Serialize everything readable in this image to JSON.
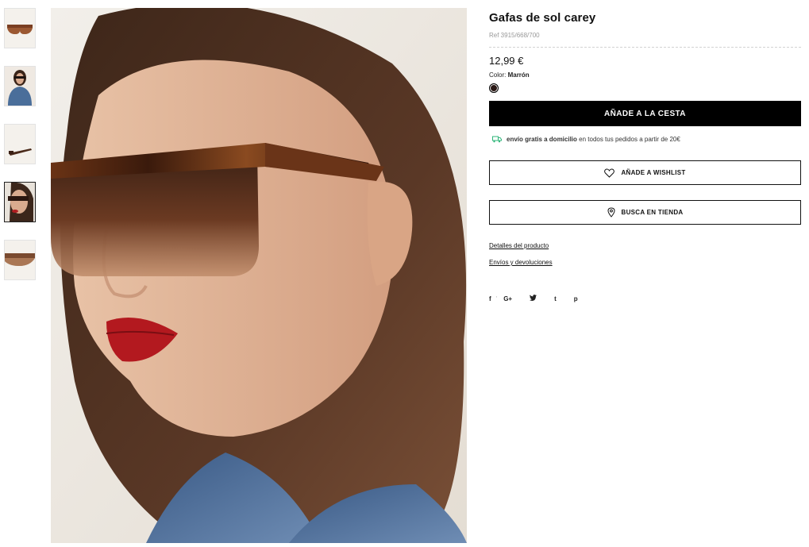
{
  "product": {
    "title": "Gafas de sol carey",
    "ref": "Ref 3915/668/700",
    "price": "12,99 €",
    "color_label": "Color:",
    "color_value": "Marrón",
    "swatch_color": "#2a1815"
  },
  "actions": {
    "add_to_cart": "AÑADE A LA CESTA",
    "wishlist": "AÑADE A WISHLIST",
    "find_store": "BUSCA EN TIENDA"
  },
  "shipping": {
    "bold": "envío gratis a domicilio",
    "rest": " en todos tus pedidos a partir de 20€",
    "icon": "truck-icon",
    "icon_color": "#2fb67a"
  },
  "links": {
    "details": "Detalles del producto",
    "returns": "Envíos y devoluciones"
  },
  "social": [
    "f",
    "G+",
    "t",
    "p"
  ],
  "thumbnails": [
    {
      "name": "thumb-front",
      "icon": "sunglasses-front"
    },
    {
      "name": "thumb-model-full",
      "icon": "model"
    },
    {
      "name": "thumb-side",
      "icon": "sunglasses-side"
    },
    {
      "name": "thumb-model-closeup",
      "icon": "model",
      "active": true
    },
    {
      "name": "thumb-detail",
      "icon": "sunglasses-detail"
    }
  ]
}
